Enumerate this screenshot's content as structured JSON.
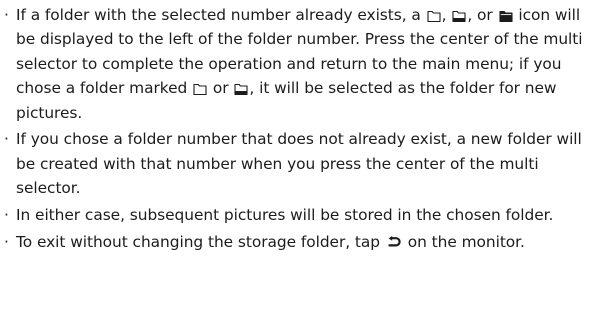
{
  "bullets": [
    {
      "dot": "·",
      "t1": "If a folder with the selected number already exists, a ",
      "t2": ", ",
      "t3": ", or ",
      "t4": " icon will be displayed to the left of the folder number. Press the center of the multi selector to complete the operation and return to the main menu; if you chose a folder marked ",
      "t5": " or ",
      "t6": ", it will be selected as the folder for new pictures."
    },
    {
      "dot": "·",
      "t1": "If you chose a folder number that does not already exist, a new folder will be created with that number when you press the center of the multi selector."
    },
    {
      "dot": "·",
      "t1": "In either case, subsequent pictures will be stored in the chosen folder."
    },
    {
      "dot": "·",
      "t1": "To exit without changing the storage folder, tap ",
      "t2": " on the monitor."
    }
  ],
  "icons": {
    "empty_folder": "folder-empty-icon",
    "partial_folder": "folder-partial-icon",
    "full_folder": "folder-full-icon",
    "return": "return-icon"
  }
}
